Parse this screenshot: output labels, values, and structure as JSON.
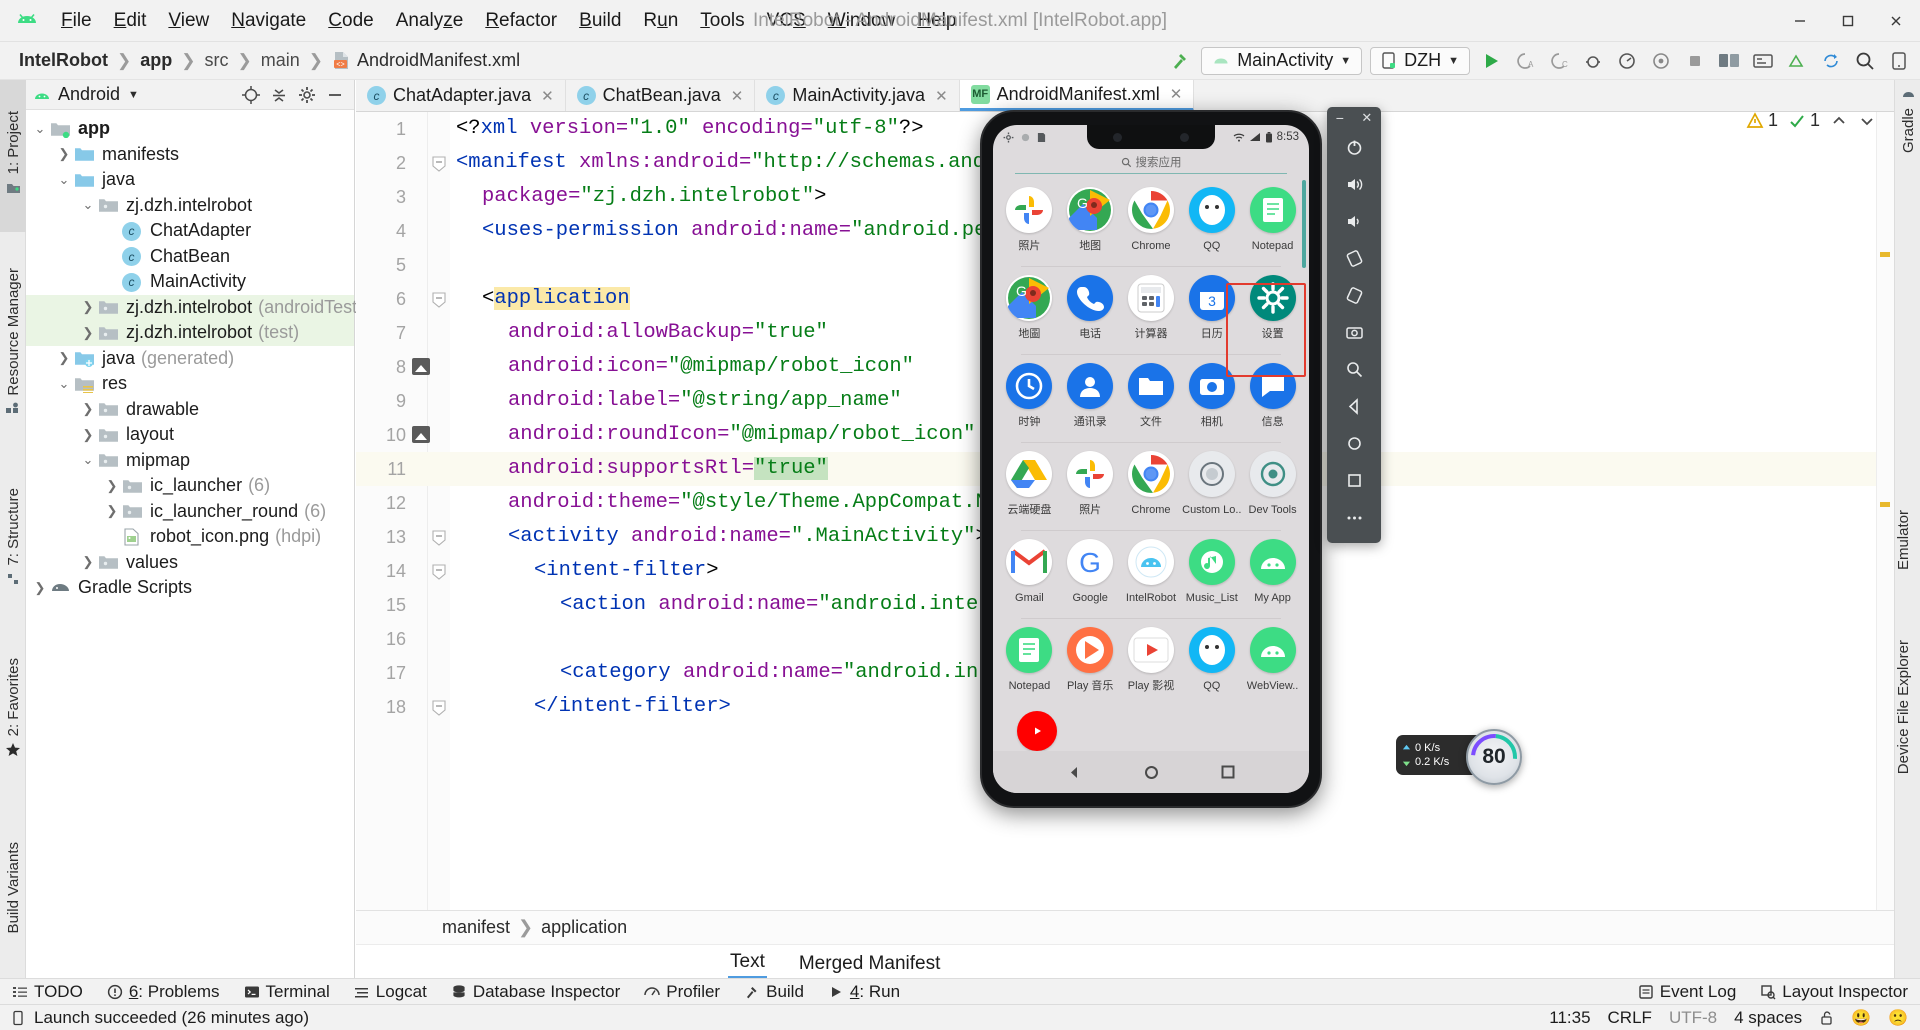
{
  "window": {
    "title": "IntelRobot - AndroidManifest.xml [IntelRobot.app]",
    "minimize": "−",
    "maximize": "▢",
    "close": "✕"
  },
  "menubar": {
    "logo_name": "android-logo",
    "items": [
      {
        "label": "File",
        "mnemonic": "F"
      },
      {
        "label": "Edit",
        "mnemonic": "E"
      },
      {
        "label": "View",
        "mnemonic": "V"
      },
      {
        "label": "Navigate",
        "mnemonic": "N"
      },
      {
        "label": "Code",
        "mnemonic": "C"
      },
      {
        "label": "Analyze",
        "mnemonic": "z"
      },
      {
        "label": "Refactor",
        "mnemonic": "R"
      },
      {
        "label": "Build",
        "mnemonic": "B"
      },
      {
        "label": "Run",
        "mnemonic": "u"
      },
      {
        "label": "Tools",
        "mnemonic": "T"
      },
      {
        "label": "VCS",
        "mnemonic": "S"
      },
      {
        "label": "Window",
        "mnemonic": "W"
      },
      {
        "label": "Help",
        "mnemonic": "H"
      }
    ]
  },
  "breadcrumb": {
    "items": [
      "IntelRobot",
      "app",
      "src",
      "main",
      "AndroidManifest.xml"
    ]
  },
  "toolbar": {
    "run_config": "MainActivity",
    "device": "DZH",
    "run_label": "Run",
    "icons": [
      "hammer-build-icon",
      "run-icon",
      "apply-changes-icon",
      "debug-icon",
      "profile-icon",
      "attach-debugger-icon",
      "stop-icon",
      "avd-manager-icon",
      "sdk-manager-icon",
      "layout-inspector-icon",
      "search-everywhere-icon",
      "device-manager-icon"
    ]
  },
  "left_rail": {
    "items": [
      {
        "label": "1: Project",
        "selected": true
      },
      {
        "label": "Resource Manager",
        "selected": false
      },
      {
        "label": "7: Structure",
        "selected": false
      },
      {
        "label": "2: Favorites",
        "selected": false
      },
      {
        "label": "Build Variants",
        "selected": false
      }
    ]
  },
  "right_rail": {
    "items": [
      {
        "label": "Gradle"
      },
      {
        "label": "Emulator"
      },
      {
        "label": "Device File Explorer"
      }
    ]
  },
  "project_panel": {
    "title": "Android",
    "header_icons": [
      "target-locate-icon",
      "collapse-all-icon",
      "settings-gear-icon",
      "hide-panel-icon"
    ],
    "tree": [
      {
        "label": "app",
        "twist": "v",
        "icon": "module-folder",
        "depth": 0,
        "bold": true,
        "sub": "",
        "highlight": false
      },
      {
        "label": "manifests",
        "twist": ">",
        "icon": "folder-blue",
        "depth": 1,
        "bold": false,
        "sub": "",
        "highlight": false
      },
      {
        "label": "java",
        "twist": "v",
        "icon": "folder-blue",
        "depth": 1,
        "bold": false,
        "sub": "",
        "highlight": false
      },
      {
        "label": "zj.dzh.intelrobot",
        "twist": "v",
        "icon": "folder-grey",
        "depth": 2,
        "bold": false,
        "sub": "",
        "highlight": false
      },
      {
        "label": "ChatAdapter",
        "twist": "",
        "icon": "class-icon",
        "depth": 3,
        "bold": false,
        "sub": "",
        "highlight": false
      },
      {
        "label": "ChatBean",
        "twist": "",
        "icon": "class-icon",
        "depth": 3,
        "bold": false,
        "sub": "",
        "highlight": false
      },
      {
        "label": "MainActivity",
        "twist": "",
        "icon": "class-icon",
        "depth": 3,
        "bold": false,
        "sub": "",
        "highlight": false
      },
      {
        "label": "zj.dzh.intelrobot",
        "twist": ">",
        "icon": "folder-grey",
        "depth": 2,
        "bold": false,
        "sub": "(androidTest)",
        "highlight": true
      },
      {
        "label": "zj.dzh.intelrobot",
        "twist": ">",
        "icon": "folder-grey",
        "depth": 2,
        "bold": false,
        "sub": "(test)",
        "highlight": true
      },
      {
        "label": "java",
        "twist": ">",
        "icon": "folder-generated",
        "depth": 1,
        "bold": false,
        "sub": "(generated)",
        "highlight": false
      },
      {
        "label": "res",
        "twist": "v",
        "icon": "folder-res",
        "depth": 1,
        "bold": false,
        "sub": "",
        "highlight": false
      },
      {
        "label": "drawable",
        "twist": ">",
        "icon": "folder-grey",
        "depth": 2,
        "bold": false,
        "sub": "",
        "highlight": false
      },
      {
        "label": "layout",
        "twist": ">",
        "icon": "folder-grey",
        "depth": 2,
        "bold": false,
        "sub": "",
        "highlight": false
      },
      {
        "label": "mipmap",
        "twist": "v",
        "icon": "folder-grey",
        "depth": 2,
        "bold": false,
        "sub": "",
        "highlight": false
      },
      {
        "label": "ic_launcher",
        "twist": ">",
        "icon": "folder-grey",
        "depth": 3,
        "bold": false,
        "sub": "(6)",
        "highlight": false
      },
      {
        "label": "ic_launcher_round",
        "twist": ">",
        "icon": "folder-grey",
        "depth": 3,
        "bold": false,
        "sub": "(6)",
        "highlight": false
      },
      {
        "label": "robot_icon.png",
        "twist": "",
        "icon": "image-file-icon",
        "depth": 3,
        "bold": false,
        "sub": "(hdpi)",
        "highlight": false
      },
      {
        "label": "values",
        "twist": ">",
        "icon": "folder-grey",
        "depth": 2,
        "bold": false,
        "sub": "",
        "highlight": false
      },
      {
        "label": "Gradle Scripts",
        "twist": ">",
        "icon": "gradle-icon",
        "depth": 0,
        "bold": false,
        "sub": "",
        "highlight": false
      }
    ]
  },
  "editor": {
    "tabs": [
      {
        "label": "ChatAdapter.java",
        "kind": "class",
        "badge": "c",
        "active": false
      },
      {
        "label": "ChatBean.java",
        "kind": "class",
        "badge": "c",
        "active": false
      },
      {
        "label": "MainActivity.java",
        "kind": "class",
        "badge": "c",
        "active": false
      },
      {
        "label": "AndroidManifest.xml",
        "kind": "manifest",
        "badge": "MF",
        "active": true
      }
    ],
    "warnings": {
      "warning_count": "1",
      "check_count": "1"
    },
    "breadcrumb_status": [
      "manifest",
      "application"
    ],
    "bottom_tabs": [
      {
        "label": "Text",
        "active": true
      },
      {
        "label": "Merged Manifest",
        "active": false
      }
    ],
    "code": [
      {
        "n": "1",
        "fold": "",
        "marker": "",
        "hl": false,
        "segs": [
          {
            "t": "<?",
            "c": "k-plain"
          },
          {
            "t": "xml",
            "c": "k-tag"
          },
          {
            "t": " version=",
            "c": "k-attr"
          },
          {
            "t": "\"1.0\"",
            "c": "k-str"
          },
          {
            "t": " encoding=",
            "c": "k-attr"
          },
          {
            "t": "\"utf-8\"",
            "c": "k-str"
          },
          {
            "t": "?>",
            "c": "k-plain"
          }
        ],
        "indent": 0
      },
      {
        "n": "2",
        "fold": "−",
        "marker": "",
        "hl": false,
        "segs": [
          {
            "t": "<manifest",
            "c": "k-tag"
          },
          {
            "t": " xmlns:android=",
            "c": "k-attr"
          },
          {
            "t": "\"http://schemas.android.com/apk/res/android\"",
            "c": "k-str"
          }
        ],
        "indent": 0
      },
      {
        "n": "3",
        "fold": "",
        "marker": "",
        "hl": false,
        "segs": [
          {
            "t": "package=",
            "c": "k-attr"
          },
          {
            "t": "\"zj.dzh.intelrobot\"",
            "c": "k-str"
          },
          {
            "t": ">",
            "c": "k-plain"
          }
        ],
        "indent": 2
      },
      {
        "n": "4",
        "fold": "",
        "marker": "",
        "hl": false,
        "segs": [
          {
            "t": "<uses-permission",
            "c": "k-tag"
          },
          {
            "t": " android:name=",
            "c": "k-attr"
          },
          {
            "t": "\"android.permission.INTERNET\"",
            "c": "k-str"
          }
        ],
        "indent": 2
      },
      {
        "n": "5",
        "fold": "",
        "marker": "",
        "hl": false,
        "segs": [],
        "indent": 0
      },
      {
        "n": "6",
        "fold": "−",
        "marker": "",
        "hl": false,
        "segs": [
          {
            "t": "<",
            "c": "k-plain"
          },
          {
            "t": "application",
            "c": "k-tag hl-word"
          }
        ],
        "indent": 2
      },
      {
        "n": "7",
        "fold": "",
        "marker": "",
        "hl": false,
        "segs": [
          {
            "t": "android:allowBackup=",
            "c": "k-attr"
          },
          {
            "t": "\"true\"",
            "c": "k-str"
          }
        ],
        "indent": 4
      },
      {
        "n": "8",
        "fold": "",
        "marker": "image",
        "hl": false,
        "segs": [
          {
            "t": "android:icon=",
            "c": "k-attr"
          },
          {
            "t": "\"@mipmap/robot_icon\"",
            "c": "k-str"
          }
        ],
        "indent": 4
      },
      {
        "n": "9",
        "fold": "",
        "marker": "",
        "hl": false,
        "segs": [
          {
            "t": "android:label=",
            "c": "k-attr"
          },
          {
            "t": "\"@string/app_name\"",
            "c": "k-str"
          }
        ],
        "indent": 4
      },
      {
        "n": "10",
        "fold": "",
        "marker": "image",
        "hl": false,
        "segs": [
          {
            "t": "android:roundIcon=",
            "c": "k-attr"
          },
          {
            "t": "\"@mipmap/robot_icon\"",
            "c": "k-str"
          }
        ],
        "indent": 4
      },
      {
        "n": "11",
        "fold": "",
        "marker": "",
        "hl": true,
        "segs": [
          {
            "t": "android:supportsRtl=",
            "c": "k-attr"
          },
          {
            "t": "\"true\"",
            "c": "str-sel"
          }
        ],
        "indent": 4
      },
      {
        "n": "12",
        "fold": "",
        "marker": "",
        "hl": false,
        "segs": [
          {
            "t": "android:theme=",
            "c": "k-attr"
          },
          {
            "t": "\"@style/Theme.AppCompat.NoActionBar\"",
            "c": "k-str"
          }
        ],
        "indent": 4
      },
      {
        "n": "13",
        "fold": "−",
        "marker": "",
        "hl": false,
        "segs": [
          {
            "t": "<activity",
            "c": "k-tag"
          },
          {
            "t": " android:name=",
            "c": "k-attr"
          },
          {
            "t": "\".MainActivity\"",
            "c": "k-str"
          },
          {
            "t": ">",
            "c": "k-plain"
          }
        ],
        "indent": 4
      },
      {
        "n": "14",
        "fold": "−",
        "marker": "",
        "hl": false,
        "segs": [
          {
            "t": "<intent-filter",
            "c": "k-tag"
          },
          {
            "t": ">",
            "c": "k-plain"
          }
        ],
        "indent": 6
      },
      {
        "n": "15",
        "fold": "",
        "marker": "",
        "hl": false,
        "segs": [
          {
            "t": "<action",
            "c": "k-tag"
          },
          {
            "t": " android:name=",
            "c": "k-attr"
          },
          {
            "t": "\"android.intent.action.MAIN\"",
            "c": "k-str"
          }
        ],
        "indent": 8
      },
      {
        "n": "16",
        "fold": "",
        "marker": "",
        "hl": false,
        "segs": [],
        "indent": 0
      },
      {
        "n": "17",
        "fold": "",
        "marker": "",
        "hl": false,
        "segs": [
          {
            "t": "<category",
            "c": "k-tag"
          },
          {
            "t": " android:name=",
            "c": "k-attr"
          },
          {
            "t": "\"android.intent.category.LAUNCHER\"",
            "c": "k-str"
          }
        ],
        "indent": 8
      },
      {
        "n": "18",
        "fold": "−",
        "marker": "",
        "hl": false,
        "segs": [
          {
            "t": "</intent-filter>",
            "c": "k-tag"
          }
        ],
        "indent": 6
      }
    ]
  },
  "emulator": {
    "status_bar": {
      "left_icons": [
        "gear-icon",
        "circle-icon",
        "sdcard-icon"
      ],
      "right_icons": [
        "wifi-icon",
        "signal-icon",
        "battery-icon"
      ],
      "time": "8:53"
    },
    "search_placeholder": "搜索应用",
    "search_icon": "search-icon",
    "nav_buttons": [
      "back-triangle-icon",
      "home-circle-icon",
      "recents-square-icon"
    ],
    "selected_app": "设置",
    "apps": [
      {
        "label": "照片",
        "icon": "google-photos-icon",
        "color": "#ffffff"
      },
      {
        "label": "地图",
        "icon": "google-maps-icon",
        "color": "#ffffff"
      },
      {
        "label": "Chrome",
        "icon": "chrome-icon",
        "color": "#ffffff"
      },
      {
        "label": "QQ",
        "icon": "qq-icon",
        "color": "#12b7f5"
      },
      {
        "label": "Notepad",
        "icon": "notepad-icon",
        "color": "#3ddc84"
      },
      {
        "label": "地圖",
        "icon": "google-maps-icon",
        "color": "#ffffff"
      },
      {
        "label": "电话",
        "icon": "phone-icon",
        "color": "#1a73e8"
      },
      {
        "label": "计算器",
        "icon": "calculator-icon",
        "color": "#ffffff"
      },
      {
        "label": "日历",
        "icon": "calendar-icon",
        "color": "#1a73e8"
      },
      {
        "label": "设置",
        "icon": "settings-gear-icon",
        "color": "#00897b"
      },
      {
        "label": "时钟",
        "icon": "clock-icon",
        "color": "#1a73e8"
      },
      {
        "label": "通讯录",
        "icon": "contacts-icon",
        "color": "#1a73e8"
      },
      {
        "label": "文件",
        "icon": "files-icon",
        "color": "#1a73e8"
      },
      {
        "label": "相机",
        "icon": "camera-icon",
        "color": "#1a73e8"
      },
      {
        "label": "信息",
        "icon": "messages-icon",
        "color": "#1a73e8"
      },
      {
        "label": "云端硬盘",
        "icon": "google-drive-icon",
        "color": "#ffffff"
      },
      {
        "label": "照片",
        "icon": "google-photos-icon",
        "color": "#ffffff"
      },
      {
        "label": "Chrome",
        "icon": "chrome-icon",
        "color": "#ffffff"
      },
      {
        "label": "Custom Lo..",
        "icon": "custom-locale-icon",
        "color": "#e8eaed"
      },
      {
        "label": "Dev Tools",
        "icon": "dev-tools-icon",
        "color": "#e8eaed"
      },
      {
        "label": "Gmail",
        "icon": "gmail-icon",
        "color": "#ffffff"
      },
      {
        "label": "Google",
        "icon": "google-icon",
        "color": "#ffffff"
      },
      {
        "label": "IntelRobot",
        "icon": "intelrobot-icon",
        "color": "#ffffff"
      },
      {
        "label": "Music_List",
        "icon": "music-list-icon",
        "color": "#3ddc84"
      },
      {
        "label": "My App",
        "icon": "my-app-icon",
        "color": "#3ddc84"
      },
      {
        "label": "Notepad",
        "icon": "notepad-icon",
        "color": "#3ddc84"
      },
      {
        "label": "Play 音乐",
        "icon": "play-music-icon",
        "color": "#ff7043"
      },
      {
        "label": "Play 影视",
        "icon": "play-movies-icon",
        "color": "#ffffff"
      },
      {
        "label": "QQ",
        "icon": "qq-icon",
        "color": "#12b7f5"
      },
      {
        "label": "WebView..",
        "icon": "webview-icon",
        "color": "#3ddc84"
      }
    ],
    "dock_app": {
      "label": "",
      "icon": "youtube-icon"
    },
    "toolbar": {
      "minimize": "−",
      "close": "✕",
      "buttons": [
        "power-icon",
        "volume-up-icon",
        "volume-down-icon",
        "rotate-left-icon",
        "rotate-right-icon",
        "screenshot-icon",
        "zoom-icon",
        "back-icon",
        "home-icon",
        "overview-icon",
        "more-icon"
      ]
    },
    "perf": {
      "upload": "0 K/s",
      "download": "0.2 K/s",
      "speed_value": "80"
    }
  },
  "bottom_bar": {
    "items": [
      {
        "label": "TODO",
        "icon": "todo-list-icon"
      },
      {
        "label": "6: Problems",
        "icon": "problems-icon",
        "mnemonic": "6"
      },
      {
        "label": "Terminal",
        "icon": "terminal-icon"
      },
      {
        "label": "Logcat",
        "icon": "logcat-icon"
      },
      {
        "label": "Database Inspector",
        "icon": "database-icon"
      },
      {
        "label": "Profiler",
        "icon": "profiler-icon"
      },
      {
        "label": "Build",
        "icon": "build-hammer-icon"
      },
      {
        "label": "4: Run",
        "icon": "run-triangle-icon",
        "mnemonic": "4"
      }
    ],
    "right_items": [
      {
        "label": "Event Log",
        "icon": "event-log-icon"
      },
      {
        "label": "Layout Inspector",
        "icon": "layout-inspector-icon"
      }
    ]
  },
  "status_bar": {
    "message": "Launch succeeded (26 minutes ago)",
    "message_icon": "device-icon",
    "time": "11:35",
    "line_separator": "CRLF",
    "encoding": "UTF-8",
    "indent": "4 spaces",
    "lock_icon": "unlocked-padlock-icon",
    "happy_icon": "😃",
    "sad_icon": "🙁"
  }
}
